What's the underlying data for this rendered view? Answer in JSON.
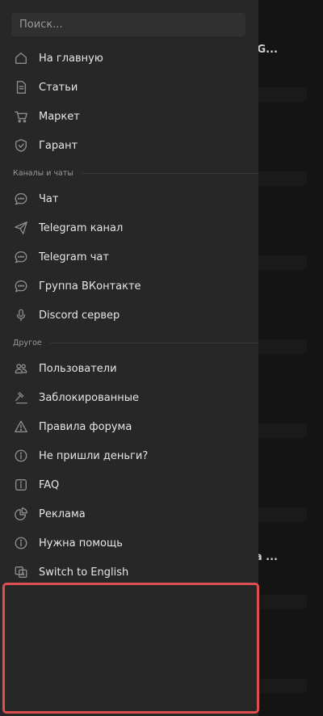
{
  "background": {
    "text_1": "[G...",
    "text_2": "а ..."
  },
  "search": {
    "placeholder": "Поиск..."
  },
  "menu": {
    "main": [
      {
        "label": "На главную",
        "icon": "home-icon"
      },
      {
        "label": "Статьи",
        "icon": "document-icon"
      },
      {
        "label": "Маркет",
        "icon": "cart-icon"
      },
      {
        "label": "Гарант",
        "icon": "shield-check-icon"
      }
    ],
    "channels_header": "Каналы и чаты",
    "channels": [
      {
        "label": "Чат",
        "icon": "chat-bubble-icon"
      },
      {
        "label": "Telegram канал",
        "icon": "telegram-send-icon"
      },
      {
        "label": "Telegram чат",
        "icon": "chat-bubble-icon"
      },
      {
        "label": "Группа ВКонтакте",
        "icon": "chat-bubble-icon"
      },
      {
        "label": "Discord сервер",
        "icon": "microphone-icon"
      }
    ],
    "other_header": "Другое",
    "other": [
      {
        "label": "Пользователи",
        "icon": "users-icon"
      },
      {
        "label": "Заблокированные",
        "icon": "gavel-icon"
      },
      {
        "label": "Правила форума",
        "icon": "warning-triangle-icon"
      },
      {
        "label": "Не пришли деньги?",
        "icon": "info-circle-icon"
      },
      {
        "label": "FAQ",
        "icon": "info-square-icon"
      },
      {
        "label": "Реклама",
        "icon": "pie-chart-icon"
      },
      {
        "label": "Нужна помощь",
        "icon": "info-circle-icon"
      },
      {
        "label": "Switch to English",
        "icon": "language-icon"
      }
    ]
  },
  "colors": {
    "drawer_bg": "#272727",
    "page_bg": "#141414",
    "icon": "#8d8d8d",
    "highlight_border": "#e04f4f"
  }
}
